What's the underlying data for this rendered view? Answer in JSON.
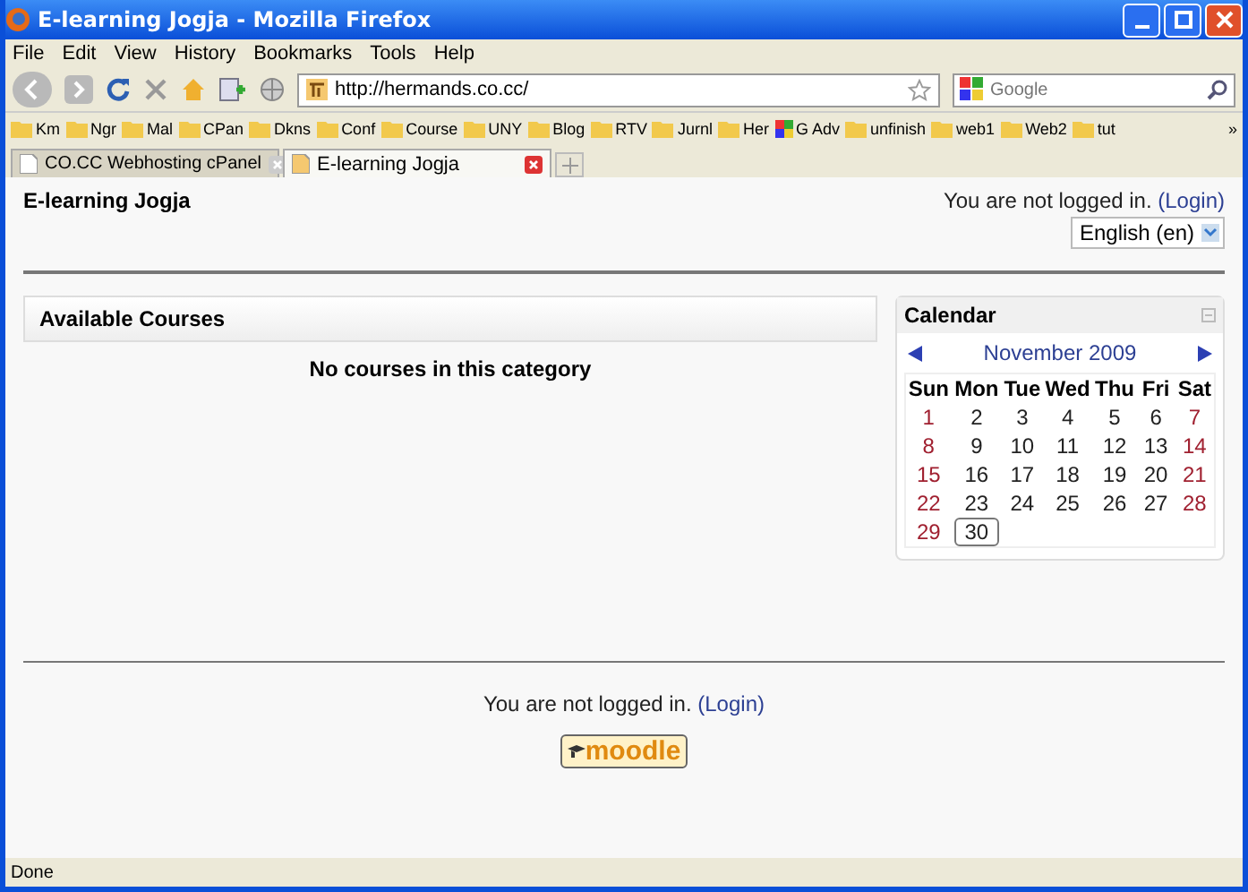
{
  "window": {
    "title": "E-learning Jogja - Mozilla Firefox"
  },
  "menu": [
    "File",
    "Edit",
    "View",
    "History",
    "Bookmarks",
    "Tools",
    "Help"
  ],
  "address": {
    "value": "http://hermands.co.cc/"
  },
  "search": {
    "placeholder": "Google"
  },
  "bookmarks": [
    {
      "label": "Km",
      "kind": "folder"
    },
    {
      "label": "Ngr",
      "kind": "folder"
    },
    {
      "label": "Mal",
      "kind": "folder"
    },
    {
      "label": "CPan",
      "kind": "folder"
    },
    {
      "label": "Dkns",
      "kind": "folder"
    },
    {
      "label": "Conf",
      "kind": "folder"
    },
    {
      "label": "Course",
      "kind": "folder"
    },
    {
      "label": "UNY",
      "kind": "folder"
    },
    {
      "label": "Blog",
      "kind": "folder"
    },
    {
      "label": "RTV",
      "kind": "folder"
    },
    {
      "label": "Jurnl",
      "kind": "folder"
    },
    {
      "label": "Her",
      "kind": "folder"
    },
    {
      "label": "G Adv",
      "kind": "site"
    },
    {
      "label": "unfinish",
      "kind": "folder"
    },
    {
      "label": "web1",
      "kind": "folder"
    },
    {
      "label": "Web2",
      "kind": "folder"
    },
    {
      "label": "tut",
      "kind": "folder"
    }
  ],
  "bookmarks_more": "»",
  "tabs": [
    {
      "label": "CO.CC Webhosting cPanel",
      "selected": false
    },
    {
      "label": "E-learning Jogja",
      "selected": true
    }
  ],
  "page": {
    "site_name": "E-learning Jogja",
    "login_text": "You are not logged in.",
    "login_link": "(Login)",
    "language": "English (en)",
    "courses": {
      "title": "Available Courses",
      "message": "No courses in this category"
    },
    "calendar": {
      "title": "Calendar",
      "month": "November 2009",
      "weekdays": [
        "Sun",
        "Mon",
        "Tue",
        "Wed",
        "Thu",
        "Fri",
        "Sat"
      ],
      "weeks": [
        [
          {
            "day": "1",
            "weekend": true,
            "today": false
          },
          {
            "day": "2",
            "weekend": false,
            "today": false
          },
          {
            "day": "3",
            "weekend": false,
            "today": false
          },
          {
            "day": "4",
            "weekend": false,
            "today": false
          },
          {
            "day": "5",
            "weekend": false,
            "today": false
          },
          {
            "day": "6",
            "weekend": false,
            "today": false
          },
          {
            "day": "7",
            "weekend": true,
            "today": false
          }
        ],
        [
          {
            "day": "8",
            "weekend": true,
            "today": false
          },
          {
            "day": "9",
            "weekend": false,
            "today": false
          },
          {
            "day": "10",
            "weekend": false,
            "today": false
          },
          {
            "day": "11",
            "weekend": false,
            "today": false
          },
          {
            "day": "12",
            "weekend": false,
            "today": false
          },
          {
            "day": "13",
            "weekend": false,
            "today": false
          },
          {
            "day": "14",
            "weekend": true,
            "today": false
          }
        ],
        [
          {
            "day": "15",
            "weekend": true,
            "today": false
          },
          {
            "day": "16",
            "weekend": false,
            "today": false
          },
          {
            "day": "17",
            "weekend": false,
            "today": false
          },
          {
            "day": "18",
            "weekend": false,
            "today": false
          },
          {
            "day": "19",
            "weekend": false,
            "today": false
          },
          {
            "day": "20",
            "weekend": false,
            "today": false
          },
          {
            "day": "21",
            "weekend": true,
            "today": false
          }
        ],
        [
          {
            "day": "22",
            "weekend": true,
            "today": false
          },
          {
            "day": "23",
            "weekend": false,
            "today": false
          },
          {
            "day": "24",
            "weekend": false,
            "today": false
          },
          {
            "day": "25",
            "weekend": false,
            "today": false
          },
          {
            "day": "26",
            "weekend": false,
            "today": false
          },
          {
            "day": "27",
            "weekend": false,
            "today": false
          },
          {
            "day": "28",
            "weekend": true,
            "today": false
          }
        ],
        [
          {
            "day": "29",
            "weekend": true,
            "today": false
          },
          {
            "day": "30",
            "weekend": false,
            "today": true
          }
        ]
      ]
    },
    "footer": {
      "login_text": "You are not logged in.",
      "login_link": "(Login)",
      "logo": "moodle"
    }
  },
  "status_bar": {
    "text": "Done"
  }
}
